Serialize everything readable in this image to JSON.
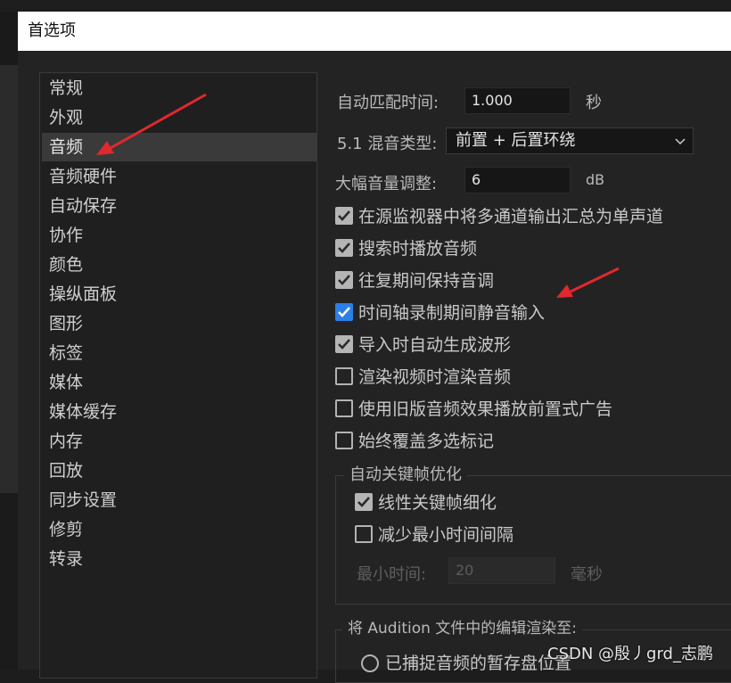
{
  "window": {
    "title": "首选项"
  },
  "sidebar": {
    "items": [
      {
        "label": "常规"
      },
      {
        "label": "外观"
      },
      {
        "label": "音频",
        "selected": true
      },
      {
        "label": "音频硬件"
      },
      {
        "label": "自动保存"
      },
      {
        "label": "协作"
      },
      {
        "label": "颜色"
      },
      {
        "label": "操纵面板"
      },
      {
        "label": "图形"
      },
      {
        "label": "标签"
      },
      {
        "label": "媒体"
      },
      {
        "label": "媒体缓存"
      },
      {
        "label": "内存"
      },
      {
        "label": "回放"
      },
      {
        "label": "同步设置"
      },
      {
        "label": "修剪"
      },
      {
        "label": "转录"
      }
    ]
  },
  "audio": {
    "auto_match": {
      "label": "自动匹配时间:",
      "value": "1.000",
      "unit": "秒"
    },
    "mix_type": {
      "label": "5.1 混音类型:",
      "value": "前置 + 后置环绕"
    },
    "volume": {
      "label": "大幅音量调整:",
      "value": "6",
      "unit": "dB"
    },
    "checkboxes": [
      {
        "label": "在源监视器中将多通道输出汇总为单声道",
        "checked": true
      },
      {
        "label": "搜索时播放音频",
        "checked": true
      },
      {
        "label": "往复期间保持音调",
        "checked": true
      },
      {
        "label": "时间轴录制期间静音输入",
        "checked": true
      },
      {
        "label": "导入时自动生成波形",
        "checked": true
      },
      {
        "label": "渲染视频时渲染音频",
        "checked": false
      },
      {
        "label": "使用旧版音频效果播放前置式广告",
        "checked": false
      },
      {
        "label": "始终覆盖多选标记",
        "checked": false
      }
    ],
    "keyframe_group": {
      "title": "自动关键帧优化",
      "linear": {
        "label": "线性关键帧细化",
        "checked": true
      },
      "reduce": {
        "label": "减少最小时间间隔",
        "checked": false
      },
      "min_time": {
        "label": "最小时间:",
        "value": "20",
        "unit": "毫秒"
      }
    },
    "render_group": {
      "title": "将 Audition 文件中的编辑渲染至:",
      "option": "已捕捉音频的暂存盘位置"
    }
  },
  "watermark": "CSDN @殷丿grd_志鹏",
  "colors": {
    "accent_checkbox": "#2b7fe6",
    "annotation_arrow": "#e0282e"
  }
}
